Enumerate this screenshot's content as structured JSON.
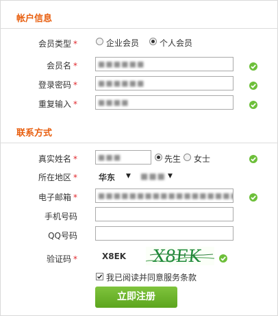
{
  "account_section": {
    "title": "帐户信息"
  },
  "account_type": {
    "label": "会员类型",
    "required_mark": "*",
    "option_enterprise": "企业会员",
    "option_personal": "个人会员",
    "selected": "个人会员"
  },
  "username": {
    "label": "会员名",
    "required_mark": "*",
    "value": "■■■■■■"
  },
  "password": {
    "label": "登录密码",
    "required_mark": "*",
    "value": "■■■■■■"
  },
  "repeat_password": {
    "label": "重复输入",
    "required_mark": "*",
    "value": "■■■■"
  },
  "contact_section": {
    "title": "联系方式"
  },
  "real_name": {
    "label": "真实姓名",
    "required_mark": "*",
    "value": "■■■",
    "gender_male": "先生",
    "gender_female": "女士",
    "gender_selected": "先生"
  },
  "region": {
    "label": "所在地区",
    "required_mark": "*",
    "province": "华东",
    "city": "■■■"
  },
  "email": {
    "label": "电子邮箱",
    "required_mark": "*",
    "value": "■■■■■■■■■■■■■■■■■■■"
  },
  "mobile": {
    "label": "手机号码",
    "value": ""
  },
  "qq": {
    "label": "QQ号码",
    "value": ""
  },
  "captcha": {
    "label": "验证码",
    "required_mark": "*",
    "value": "X8EK",
    "image_text": "X8EK"
  },
  "agreement": {
    "text": "我已阅读并同意服务条款",
    "checked": true
  },
  "submit": {
    "label": "立即注册"
  },
  "colors": {
    "section_title": "#e85e0e",
    "required": "#e0282d",
    "valid_check": "#6dbf3a",
    "button": "#6aaf2a"
  },
  "icons": {
    "validation": "check-circle-icon"
  }
}
